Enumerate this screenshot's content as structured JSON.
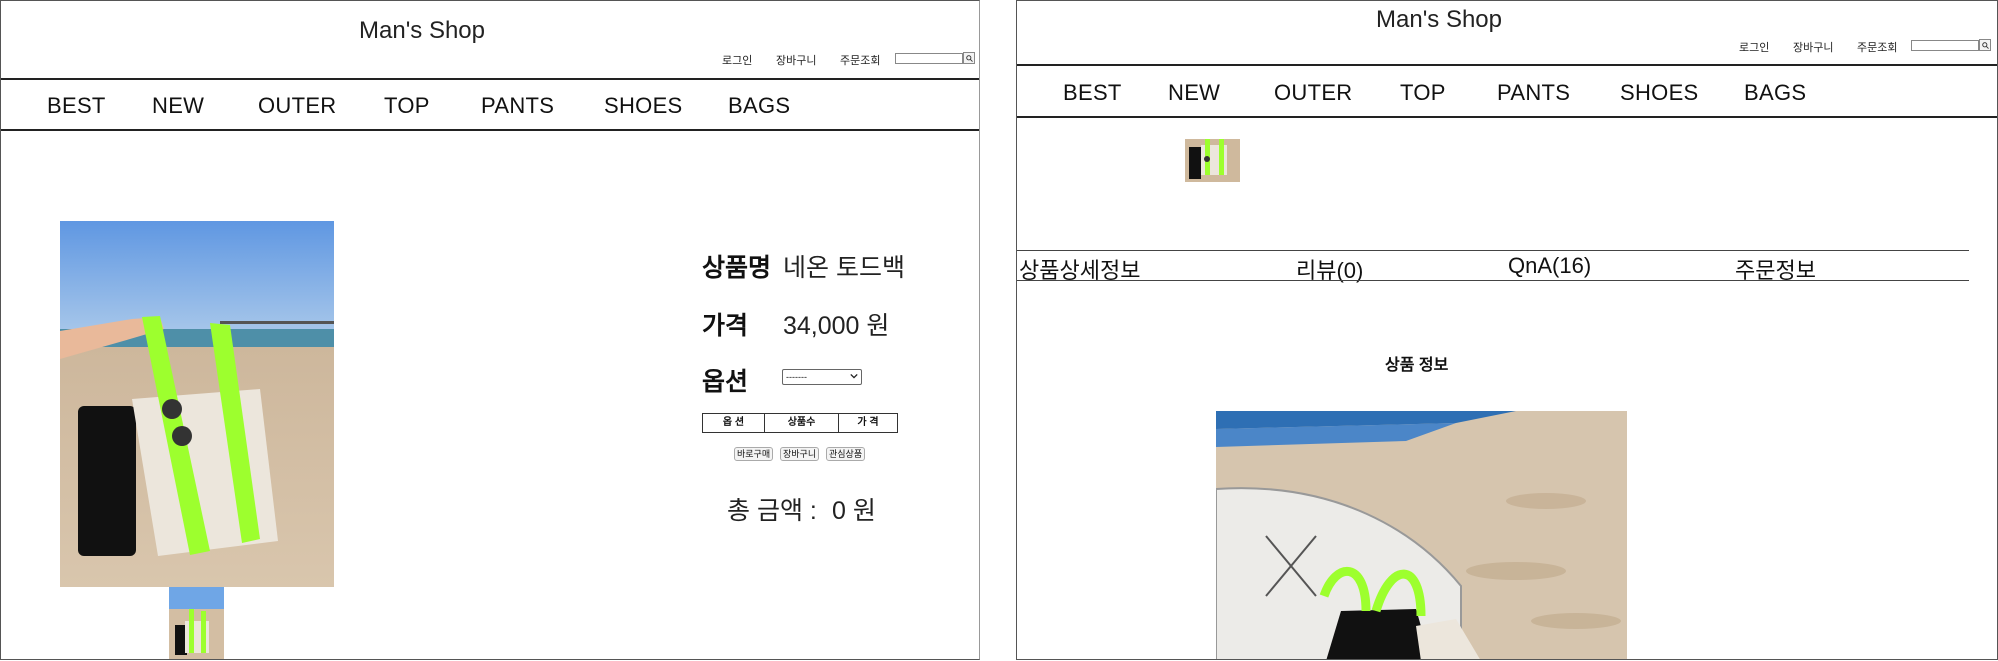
{
  "left": {
    "header": {
      "title": "Man's Shop",
      "links": [
        "로그인",
        "장바구니",
        "주문조회"
      ],
      "search_placeholder": ""
    },
    "nav": [
      "BEST",
      "NEW",
      "OUTER",
      "TOP",
      "PANTS",
      "SHOES",
      "BAGS"
    ],
    "product": {
      "name_label": "상품명",
      "name_value": "네온 토드백",
      "price_label": "가격",
      "price_value": "34,000 원",
      "option_label": "옵션",
      "option_selected": "-------",
      "table_headers": [
        "옵 션",
        "상품수",
        "가 격"
      ],
      "buttons": [
        "바로구매",
        "장바구니",
        "관심상품"
      ],
      "total_label": "총 금액 :",
      "total_value": "0 원"
    }
  },
  "right": {
    "header": {
      "title": "Man's Shop",
      "links": [
        "로그인",
        "장바구니",
        "주문조회"
      ],
      "search_placeholder": ""
    },
    "nav": [
      "BEST",
      "NEW",
      "OUTER",
      "TOP",
      "PANTS",
      "SHOES",
      "BAGS"
    ],
    "tabs": [
      "상품상세정보",
      "리뷰(0)",
      "QnA(16)",
      "주문정보"
    ],
    "section_title": "상품 정보"
  },
  "colors": {
    "neon_green": "#9dff2e",
    "sky": "#6fa6e6",
    "sand": "#d8c2a5",
    "bag_cream": "#ece6dc"
  }
}
